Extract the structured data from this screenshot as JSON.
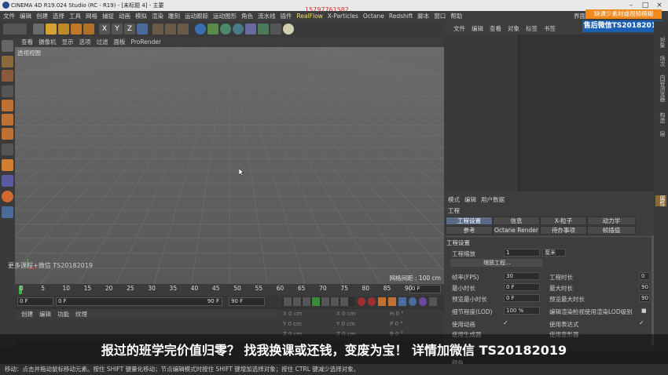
{
  "window": {
    "title": "CINEMA 4D R19.024 Studio (RC - R19) - [未标题 4] - 主要"
  },
  "menubar": [
    "文件",
    "编辑",
    "创建",
    "选择",
    "工具",
    "网格",
    "捕捉",
    "动画",
    "模拟",
    "渲染",
    "雕刻",
    "运动跟踪",
    "运动图形",
    "角色",
    "流水线",
    "插件",
    "RealFlow",
    "X-Particles",
    "Octane",
    "Redshift",
    "脚本",
    "窗口",
    "帮助"
  ],
  "menubar_right": "界面",
  "toolbar": {
    "x_label": "X",
    "y_label": "Y",
    "z_label": "Z"
  },
  "viewport": {
    "menu": [
      "查看",
      "摄像机",
      "显示",
      "选项",
      "过滤",
      "面板",
      "ProRender"
    ],
    "label": "透视视图",
    "grid_info": "网格间距 : 100 cm"
  },
  "watermark": "15797761582",
  "bottom_watermark": "更多课程+微信 TS20182019",
  "timeline": {
    "ticks": [
      "0",
      "5",
      "10",
      "15",
      "20",
      "25",
      "30",
      "35",
      "40",
      "45",
      "50",
      "55",
      "60",
      "65",
      "70",
      "75",
      "80",
      "85",
      "90"
    ],
    "end_field": "0 F"
  },
  "playbar": {
    "current": "0 F",
    "start": "0 F",
    "end": "90 F",
    "max": "90 F"
  },
  "material_menu": [
    "创建",
    "编辑",
    "功能",
    "纹理"
  ],
  "coords": {
    "x": "X  0 cm",
    "y": "Y  0 cm",
    "z": "Z  0 cm",
    "x2": "X  0 cm",
    "y2": "Y  0 cm",
    "z2": "Z  0 cm",
    "h": "H  0 °",
    "p": "P  0 °",
    "b": "B  0 °"
  },
  "object_menu": [
    "文件",
    "编辑",
    "查看",
    "对象",
    "标签",
    "书签"
  ],
  "attributes": {
    "menu": [
      "模式",
      "编辑",
      "用户数据"
    ],
    "title": "工程",
    "tabs_row1": [
      "工程设置",
      "信息",
      "X-粒子",
      "动力学"
    ],
    "tabs_row2": [
      "参考",
      "Octane Render",
      "待办事项",
      "帧插值"
    ],
    "section": "工程设置",
    "scale_label": "工程缩放",
    "scale_value": "1",
    "scale_unit": "厘米",
    "scale_button": "缩放工程...",
    "fps_label": "帧率(FPS)",
    "fps_value": "30",
    "duration_label": "工程时长",
    "duration_value": "0",
    "min_label": "最小时长",
    "min_value": "0 F",
    "max_label": "最大时长",
    "max_value": "90",
    "pmin_label": "预览最小时长",
    "pmin_value": "0 F",
    "pmax_label": "预览最大时长",
    "pmax_value": "90",
    "lod_label": "细节程度(LOD)",
    "lod_value": "100 %",
    "lod_render_label": "编辑渲染检视使用渲染LOD级别",
    "use_anim": "使用动画",
    "use_expr": "使用表达式",
    "use_gen": "使用生成器",
    "use_deform": "使用变形器",
    "color_label": "颜色"
  },
  "sidebar_tabs": [
    "对象",
    "场次",
    "内容浏览器",
    "构造",
    "层"
  ],
  "sidebar_tabs_bottom": [
    "属性"
  ],
  "promo": {
    "top": "缺课少素材或视频模糊",
    "bottom": "售后微信TS20182019"
  },
  "banner": "报过的班学完价值归零？ 找我换课或还钱，变废为宝！ 详情加微信 TS20182019",
  "status": "移动：点击并拖动鼠标移动元素。按住 SHIFT 键量化移动；节点编辑模式时按住 SHIFT 键增加选择对象；按住 CTRL 键减少选择对象。"
}
